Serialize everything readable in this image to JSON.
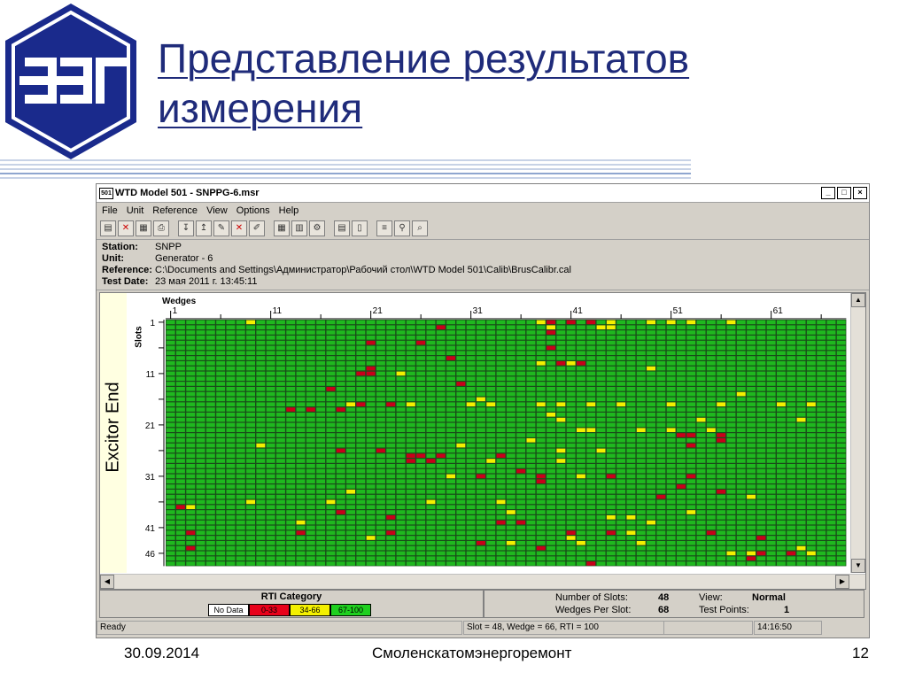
{
  "slide": {
    "title": "Представление результатов измерения",
    "footer_date": "30.09.2014",
    "footer_org": "Смоленскатомэнергоремонт",
    "page_number": "12",
    "title_color": "#1f2b7a"
  },
  "window": {
    "app_icon": "501",
    "title": "WTD Model 501 - SNPPG-6.msr",
    "menu": [
      "File",
      "Unit",
      "Reference",
      "View",
      "Options",
      "Help"
    ],
    "info": [
      {
        "key": "Station:",
        "value": "SNPP"
      },
      {
        "key": "Unit:",
        "value": "Generator - 6"
      },
      {
        "key": "Reference:",
        "value": "C:\\Documents and Settings\\Администратор\\Рабочий стол\\WTD Model 501\\Calib\\BrusCalibr.cal"
      },
      {
        "key": "Test Date:",
        "value": "23 мая 2011 г.  13:45:11"
      }
    ],
    "plot": {
      "side_label": "Excitor End",
      "wedges_label": "Wedges",
      "slots_label": "Slots",
      "wedge_ticks": [
        "1",
        "11",
        "21",
        "31",
        "41",
        "51",
        "61"
      ],
      "slot_ticks": [
        "1",
        "11",
        "21",
        "31",
        "41",
        "46"
      ],
      "num_slots": 48,
      "num_wedges": 68,
      "colors": {
        "green": "#1fb81f",
        "yellow": "#f4f000",
        "red": "#c8001a",
        "grid": "#1a4d1a"
      },
      "flagged_cells": {
        "yellow": [
          [
            1,
            9
          ],
          [
            1,
            38
          ],
          [
            1,
            45
          ],
          [
            1,
            49
          ],
          [
            1,
            51
          ],
          [
            1,
            53
          ],
          [
            1,
            57
          ],
          [
            2,
            39
          ],
          [
            2,
            44
          ],
          [
            2,
            45
          ],
          [
            9,
            38
          ],
          [
            9,
            41
          ],
          [
            10,
            49
          ],
          [
            11,
            24
          ],
          [
            15,
            58
          ],
          [
            16,
            32
          ],
          [
            17,
            19
          ],
          [
            17,
            25
          ],
          [
            17,
            31
          ],
          [
            17,
            33
          ],
          [
            17,
            38
          ],
          [
            17,
            40
          ],
          [
            17,
            43
          ],
          [
            17,
            46
          ],
          [
            17,
            51
          ],
          [
            17,
            56
          ],
          [
            17,
            62
          ],
          [
            17,
            65
          ],
          [
            19,
            39
          ],
          [
            20,
            40
          ],
          [
            20,
            54
          ],
          [
            20,
            64
          ],
          [
            22,
            42
          ],
          [
            22,
            43
          ],
          [
            22,
            48
          ],
          [
            22,
            51
          ],
          [
            22,
            55
          ],
          [
            24,
            37
          ],
          [
            25,
            10
          ],
          [
            25,
            30
          ],
          [
            26,
            40
          ],
          [
            26,
            44
          ],
          [
            28,
            33
          ],
          [
            28,
            40
          ],
          [
            31,
            29
          ],
          [
            31,
            42
          ],
          [
            34,
            19
          ],
          [
            35,
            59
          ],
          [
            36,
            9
          ],
          [
            36,
            17
          ],
          [
            36,
            27
          ],
          [
            36,
            34
          ],
          [
            37,
            3
          ],
          [
            38,
            35
          ],
          [
            38,
            53
          ],
          [
            39,
            45
          ],
          [
            39,
            47
          ],
          [
            40,
            14
          ],
          [
            40,
            49
          ],
          [
            42,
            47
          ],
          [
            43,
            21
          ],
          [
            43,
            41
          ],
          [
            44,
            35
          ],
          [
            44,
            42
          ],
          [
            44,
            48
          ],
          [
            45,
            64
          ],
          [
            46,
            57
          ],
          [
            46,
            59
          ],
          [
            46,
            65
          ]
        ],
        "red": [
          [
            1,
            39
          ],
          [
            1,
            41
          ],
          [
            1,
            43
          ],
          [
            2,
            28
          ],
          [
            3,
            39
          ],
          [
            5,
            21
          ],
          [
            5,
            26
          ],
          [
            6,
            39
          ],
          [
            8,
            29
          ],
          [
            9,
            40
          ],
          [
            9,
            42
          ],
          [
            10,
            21
          ],
          [
            11,
            20
          ],
          [
            11,
            21
          ],
          [
            13,
            30
          ],
          [
            14,
            17
          ],
          [
            17,
            20
          ],
          [
            17,
            23
          ],
          [
            18,
            13
          ],
          [
            18,
            15
          ],
          [
            18,
            18
          ],
          [
            23,
            52
          ],
          [
            23,
            53
          ],
          [
            23,
            56
          ],
          [
            24,
            56
          ],
          [
            25,
            53
          ],
          [
            26,
            18
          ],
          [
            26,
            22
          ],
          [
            27,
            25
          ],
          [
            27,
            26
          ],
          [
            27,
            28
          ],
          [
            27,
            34
          ],
          [
            28,
            25
          ],
          [
            28,
            27
          ],
          [
            30,
            36
          ],
          [
            31,
            32
          ],
          [
            31,
            38
          ],
          [
            31,
            45
          ],
          [
            31,
            53
          ],
          [
            32,
            38
          ],
          [
            33,
            52
          ],
          [
            34,
            56
          ],
          [
            35,
            50
          ],
          [
            37,
            2
          ],
          [
            38,
            18
          ],
          [
            39,
            23
          ],
          [
            40,
            34
          ],
          [
            40,
            36
          ],
          [
            42,
            3
          ],
          [
            42,
            14
          ],
          [
            42,
            23
          ],
          [
            42,
            41
          ],
          [
            42,
            45
          ],
          [
            42,
            55
          ],
          [
            43,
            60
          ],
          [
            44,
            32
          ],
          [
            45,
            3
          ],
          [
            45,
            38
          ],
          [
            46,
            60
          ],
          [
            46,
            63
          ],
          [
            47,
            59
          ],
          [
            48,
            43
          ]
        ]
      }
    },
    "legend": {
      "title": "RTI Category",
      "items": [
        {
          "label": "No Data",
          "color": "#ffffff"
        },
        {
          "label": "0-33",
          "color": "#e8001a"
        },
        {
          "label": "34-66",
          "color": "#f4f000"
        },
        {
          "label": "67-100",
          "color": "#1fd01f"
        }
      ]
    },
    "stats": {
      "num_slots_label": "Number of Slots:",
      "num_slots": "48",
      "wedges_label": "Wedges Per Slot:",
      "wedges": "68",
      "view_label": "View:",
      "view": "Normal",
      "tp_label": "Test Points:",
      "tp": "1"
    },
    "status": {
      "ready": "Ready",
      "selection": "Slot = 48, Wedge = 66, RTI = 100",
      "time": "14:16:50"
    }
  }
}
